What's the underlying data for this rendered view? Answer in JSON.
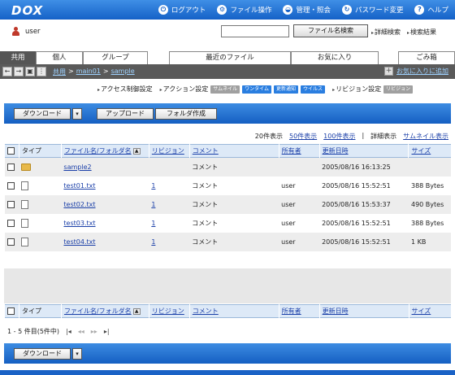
{
  "app": {
    "logo": "DOX",
    "nav": [
      {
        "label": "ログアウト",
        "icon": "logout-icon",
        "glyph": "⏻"
      },
      {
        "label": "ファイル操作",
        "icon": "file-ops-icon",
        "glyph": "⚙"
      },
      {
        "label": "管理・照会",
        "icon": "admin-icon",
        "glyph": "◒"
      },
      {
        "label": "パスワード変更",
        "icon": "password-icon",
        "glyph": "↻"
      },
      {
        "label": "ヘルプ",
        "icon": "help-icon",
        "glyph": "?"
      }
    ]
  },
  "user": {
    "name": "user"
  },
  "search": {
    "value": "",
    "button": "ファイル名検索",
    "links": [
      "詳細検索",
      "検索結果"
    ]
  },
  "tabs": [
    "共用",
    "個人",
    "グループ",
    "最近のファイル",
    "お気に入り",
    "ごみ箱"
  ],
  "breadcrumb": {
    "items": [
      "共用",
      "main01",
      "sample"
    ],
    "sep": ">",
    "favorite_add": "お気に入りに追加"
  },
  "settings": {
    "access": "アクセス制御設定",
    "action": "アクション設定",
    "chips": [
      {
        "label": "サムネイル",
        "color": "gray"
      },
      {
        "label": "ワンタイム",
        "color": "blue"
      },
      {
        "label": "更新通知",
        "color": "blue"
      },
      {
        "label": "ウイルス",
        "color": "blue"
      }
    ],
    "revision": "リビジョン設定",
    "revision_chip": "リビジョン"
  },
  "actions": {
    "download": "ダウンロード",
    "upload": "アップロード",
    "create_folder": "フォルダ作成",
    "dropdown_glyph": "▾"
  },
  "pagesize": {
    "options": [
      "20件表示",
      "50件表示",
      "100件表示"
    ],
    "detail": "詳細表示",
    "thumbnail": "サムネイル表示"
  },
  "table": {
    "headers": {
      "type": "タイプ",
      "name": "ファイル名/フォルダ名",
      "revision": "リビジョン",
      "comment": "コメント",
      "owner": "所有者",
      "updated": "更新日時",
      "size": "サイズ"
    },
    "rows": [
      {
        "type": "folder",
        "name": "sample2",
        "revision": "",
        "comment": "コメント",
        "owner": "",
        "updated": "2005/08/16 16:13:25",
        "size": ""
      },
      {
        "type": "file",
        "name": "test01.txt",
        "revision": "1",
        "comment": "コメント",
        "owner": "user",
        "updated": "2005/08/16 15:52:51",
        "size": "388 Bytes"
      },
      {
        "type": "file",
        "name": "test02.txt",
        "revision": "1",
        "comment": "コメント",
        "owner": "user",
        "updated": "2005/08/16 15:53:37",
        "size": "490 Bytes"
      },
      {
        "type": "file",
        "name": "test03.txt",
        "revision": "1",
        "comment": "コメント",
        "owner": "user",
        "updated": "2005/08/16 15:52:51",
        "size": "388 Bytes"
      },
      {
        "type": "file",
        "name": "test04.txt",
        "revision": "1",
        "comment": "コメント",
        "owner": "user",
        "updated": "2005/08/16 15:52:51",
        "size": "1 KB"
      }
    ]
  },
  "pager": {
    "summary": "1 - 5 件目(5件中)",
    "first": "|◂",
    "prev": "◂◂",
    "next": "▸▸",
    "last": "▸|"
  }
}
